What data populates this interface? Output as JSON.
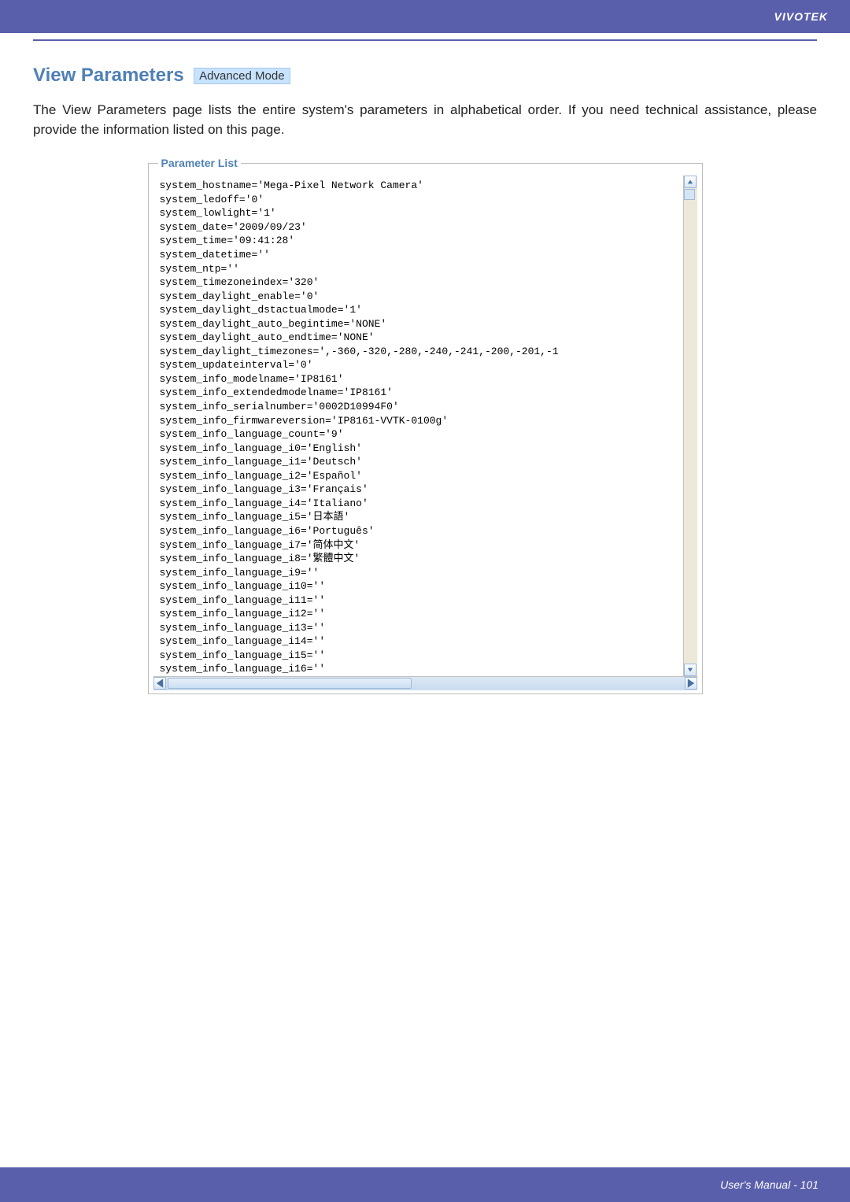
{
  "brand": "VIVOTEK",
  "page_title": "View Parameters",
  "mode_badge": "Advanced Mode",
  "intro": "The View Parameters page lists the entire system's parameters in alphabetical order. If you need technical assistance, please provide the information listed on this page.",
  "panel_title": "Parameter List",
  "footer": "User's Manual - 101",
  "parameters": [
    "system_hostname='Mega-Pixel Network Camera'",
    "system_ledoff='0'",
    "system_lowlight='1'",
    "system_date='2009/09/23'",
    "system_time='09:41:28'",
    "system_datetime=''",
    "system_ntp=''",
    "system_timezoneindex='320'",
    "system_daylight_enable='0'",
    "system_daylight_dstactualmode='1'",
    "system_daylight_auto_begintime='NONE'",
    "system_daylight_auto_endtime='NONE'",
    "system_daylight_timezones=',-360,-320,-280,-240,-241,-200,-201,-1",
    "system_updateinterval='0'",
    "system_info_modelname='IP8161'",
    "system_info_extendedmodelname='IP8161'",
    "system_info_serialnumber='0002D10994F0'",
    "system_info_firmwareversion='IP8161-VVTK-0100g'",
    "system_info_language_count='9'",
    "system_info_language_i0='English'",
    "system_info_language_i1='Deutsch'",
    "system_info_language_i2='Español'",
    "system_info_language_i3='Français'",
    "system_info_language_i4='Italiano'",
    "system_info_language_i5='日本語'",
    "system_info_language_i6='Português'",
    "system_info_language_i7='简体中文'",
    "system_info_language_i8='繁體中文'",
    "system_info_language_i9=''",
    "system_info_language_i10=''",
    "system_info_language_i11=''",
    "system_info_language_i12=''",
    "system_info_language_i13=''",
    "system_info_language_i14=''",
    "system_info_language_i15=''",
    "system_info_language_i16=''"
  ]
}
